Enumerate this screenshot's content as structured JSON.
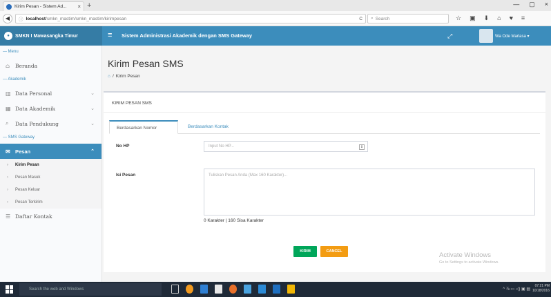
{
  "browser": {
    "tab_title": "Kirim Pesan - Sistem Ad...",
    "tab_close": "×",
    "new_tab": "+",
    "url_host": "localhost",
    "url_path": "/smkn_mastim/smkn_mastim/kirimpesan",
    "reload": "C",
    "search_placeholder": "Search",
    "window_controls": [
      "—",
      "▢",
      "×"
    ],
    "tool_icons": [
      "☆",
      "▣",
      "⬇",
      "⌂",
      "♥",
      "≡"
    ]
  },
  "header": {
    "brand": "SMKN I Mawasangka Timur",
    "system_title": "Sistem Administrasi Akademik dengan SMS Gateway",
    "hamburger": "≡",
    "expand": "⤢",
    "user_name": "Wa Ode Marlasa ▾"
  },
  "sidebar": {
    "menu_header": "— Menu",
    "beranda": "Beranda",
    "akademik_header": "— Akademik",
    "data_personal": "Data Personal",
    "data_akademik": "Data Akademik",
    "data_pendukung": "Data Pendukung",
    "sms_header": "— SMS Gateway",
    "pesan": "Pesan",
    "sub_items": [
      "Kirim Pesan",
      "Pesan Masuk",
      "Pesan Keluar",
      "Pesan Terkirim"
    ],
    "daftar_kontak": "Daftar Kontak"
  },
  "content": {
    "page_title": "Kirim Pesan SMS",
    "breadcrumb_sep": "/",
    "breadcrumb_current": "Kirim Pesan",
    "box_title": "KIRIM PESAN SMS",
    "tab_nomor": "Berdasarkan Nomor",
    "tab_kontak": "Berdasarkan Kontak",
    "label_nohp": "No HP",
    "nohp_placeholder": "Input No HP...",
    "label_isi": "Isi Pesan",
    "isi_placeholder": "Tuliskan Pesan Anda (Max 160 Karakter)...",
    "counter": "0 Karakter | 160 Sisa Karakter",
    "btn_kirim": "KIRIM",
    "btn_cancel": "CANCEL"
  },
  "watermark": {
    "title": "Activate Windows",
    "subtitle": "Go to Settings to activate Windows."
  },
  "taskbar": {
    "search": "Search the web and Windows",
    "time": "07:21 PM",
    "date": "10/18/2016",
    "tray": "^ ⅞ ▭ ◁) ▣ ▤"
  },
  "colors": {
    "primary": "#3c8dbc",
    "brand_bg": "#357ca5",
    "success": "#00a65a",
    "warning": "#f39c12"
  }
}
